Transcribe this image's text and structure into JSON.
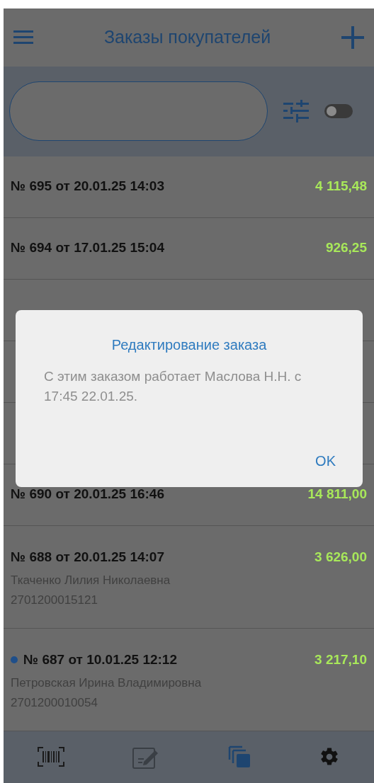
{
  "header": {
    "title": "Заказы покупателей"
  },
  "filter": {
    "toggle_on": false
  },
  "orders": [
    {
      "kind": "order",
      "title": "№ 695 от 20.01.25 14:03",
      "amount": "4 115,48",
      "marked": false
    },
    {
      "kind": "order",
      "title": "№ 694 от 17.01.25 15:04",
      "amount": "926,25",
      "marked": false
    },
    {
      "kind": "covered"
    },
    {
      "kind": "covered"
    },
    {
      "kind": "covered"
    },
    {
      "kind": "order",
      "title": "№ 690 от 20.01.25 16:46",
      "amount": "14 811,00",
      "marked": false
    },
    {
      "kind": "order",
      "title": "№ 688 от 20.01.25 14:07",
      "amount": "3 626,00",
      "marked": false,
      "customer": "Ткаченко Лилия Николаевна",
      "code": "2701200015121"
    },
    {
      "kind": "order",
      "title": "№ 687 от 10.01.25 12:12",
      "amount": "3 217,10",
      "marked": true,
      "customer": "Петровская Ирина Владимировна",
      "code": "2701200010054"
    }
  ],
  "dialog": {
    "title": "Редактирование заказа",
    "message": "С этим заказом работает Маслова Н.Н. с 17:45 22.01.25.",
    "button": "OK"
  }
}
